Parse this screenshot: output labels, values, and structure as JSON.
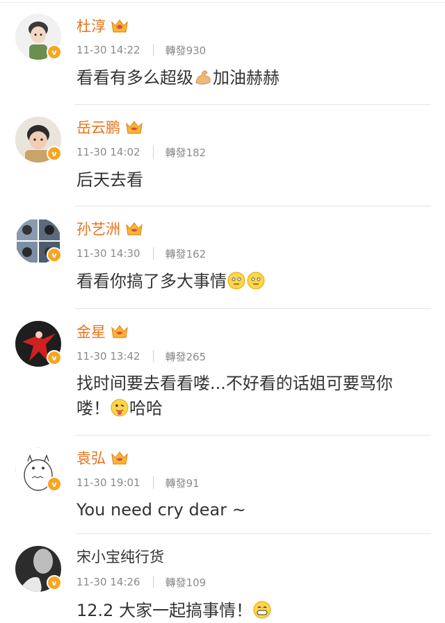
{
  "comments": [
    {
      "name": "杜淳",
      "vip": true,
      "time": "11-30 14:22",
      "repost": "轉發930",
      "text": "看看有多么超级",
      "text2": "加油赫赫",
      "emoji": "flexed-biceps"
    },
    {
      "name": "岳云鹏",
      "vip": true,
      "time": "11-30 14:02",
      "repost": "轉發182",
      "text": "后天去看"
    },
    {
      "name": "孙艺洲",
      "vip": true,
      "time": "11-30 14:30",
      "repost": "轉發162",
      "text": "看看你搞了多大事情",
      "emoji": "thinking-face"
    },
    {
      "name": "金星",
      "vip": true,
      "time": "11-30 13:42",
      "repost": "轉發265",
      "text": "找时间要去看看喽...不好看的话姐可要骂你",
      "line2": "喽！",
      "line2b": "哈哈",
      "emoji": "tongue-face"
    },
    {
      "name": "袁弘",
      "vip": true,
      "time": "11-30 19:01",
      "repost": "轉發91",
      "text": "You need cry dear ~"
    },
    {
      "name": "宋小宝纯行货",
      "vip": false,
      "time": "11-30 14:26",
      "repost": "轉發109",
      "text": "12.2 大家一起搞事情！",
      "emoji": "grinning-face"
    }
  ],
  "badge_label": "v",
  "colors": {
    "vip_name": "#e8731b",
    "badge": "#f5a623",
    "meta": "#8a8a8a",
    "divider": "#e4e4e4"
  }
}
